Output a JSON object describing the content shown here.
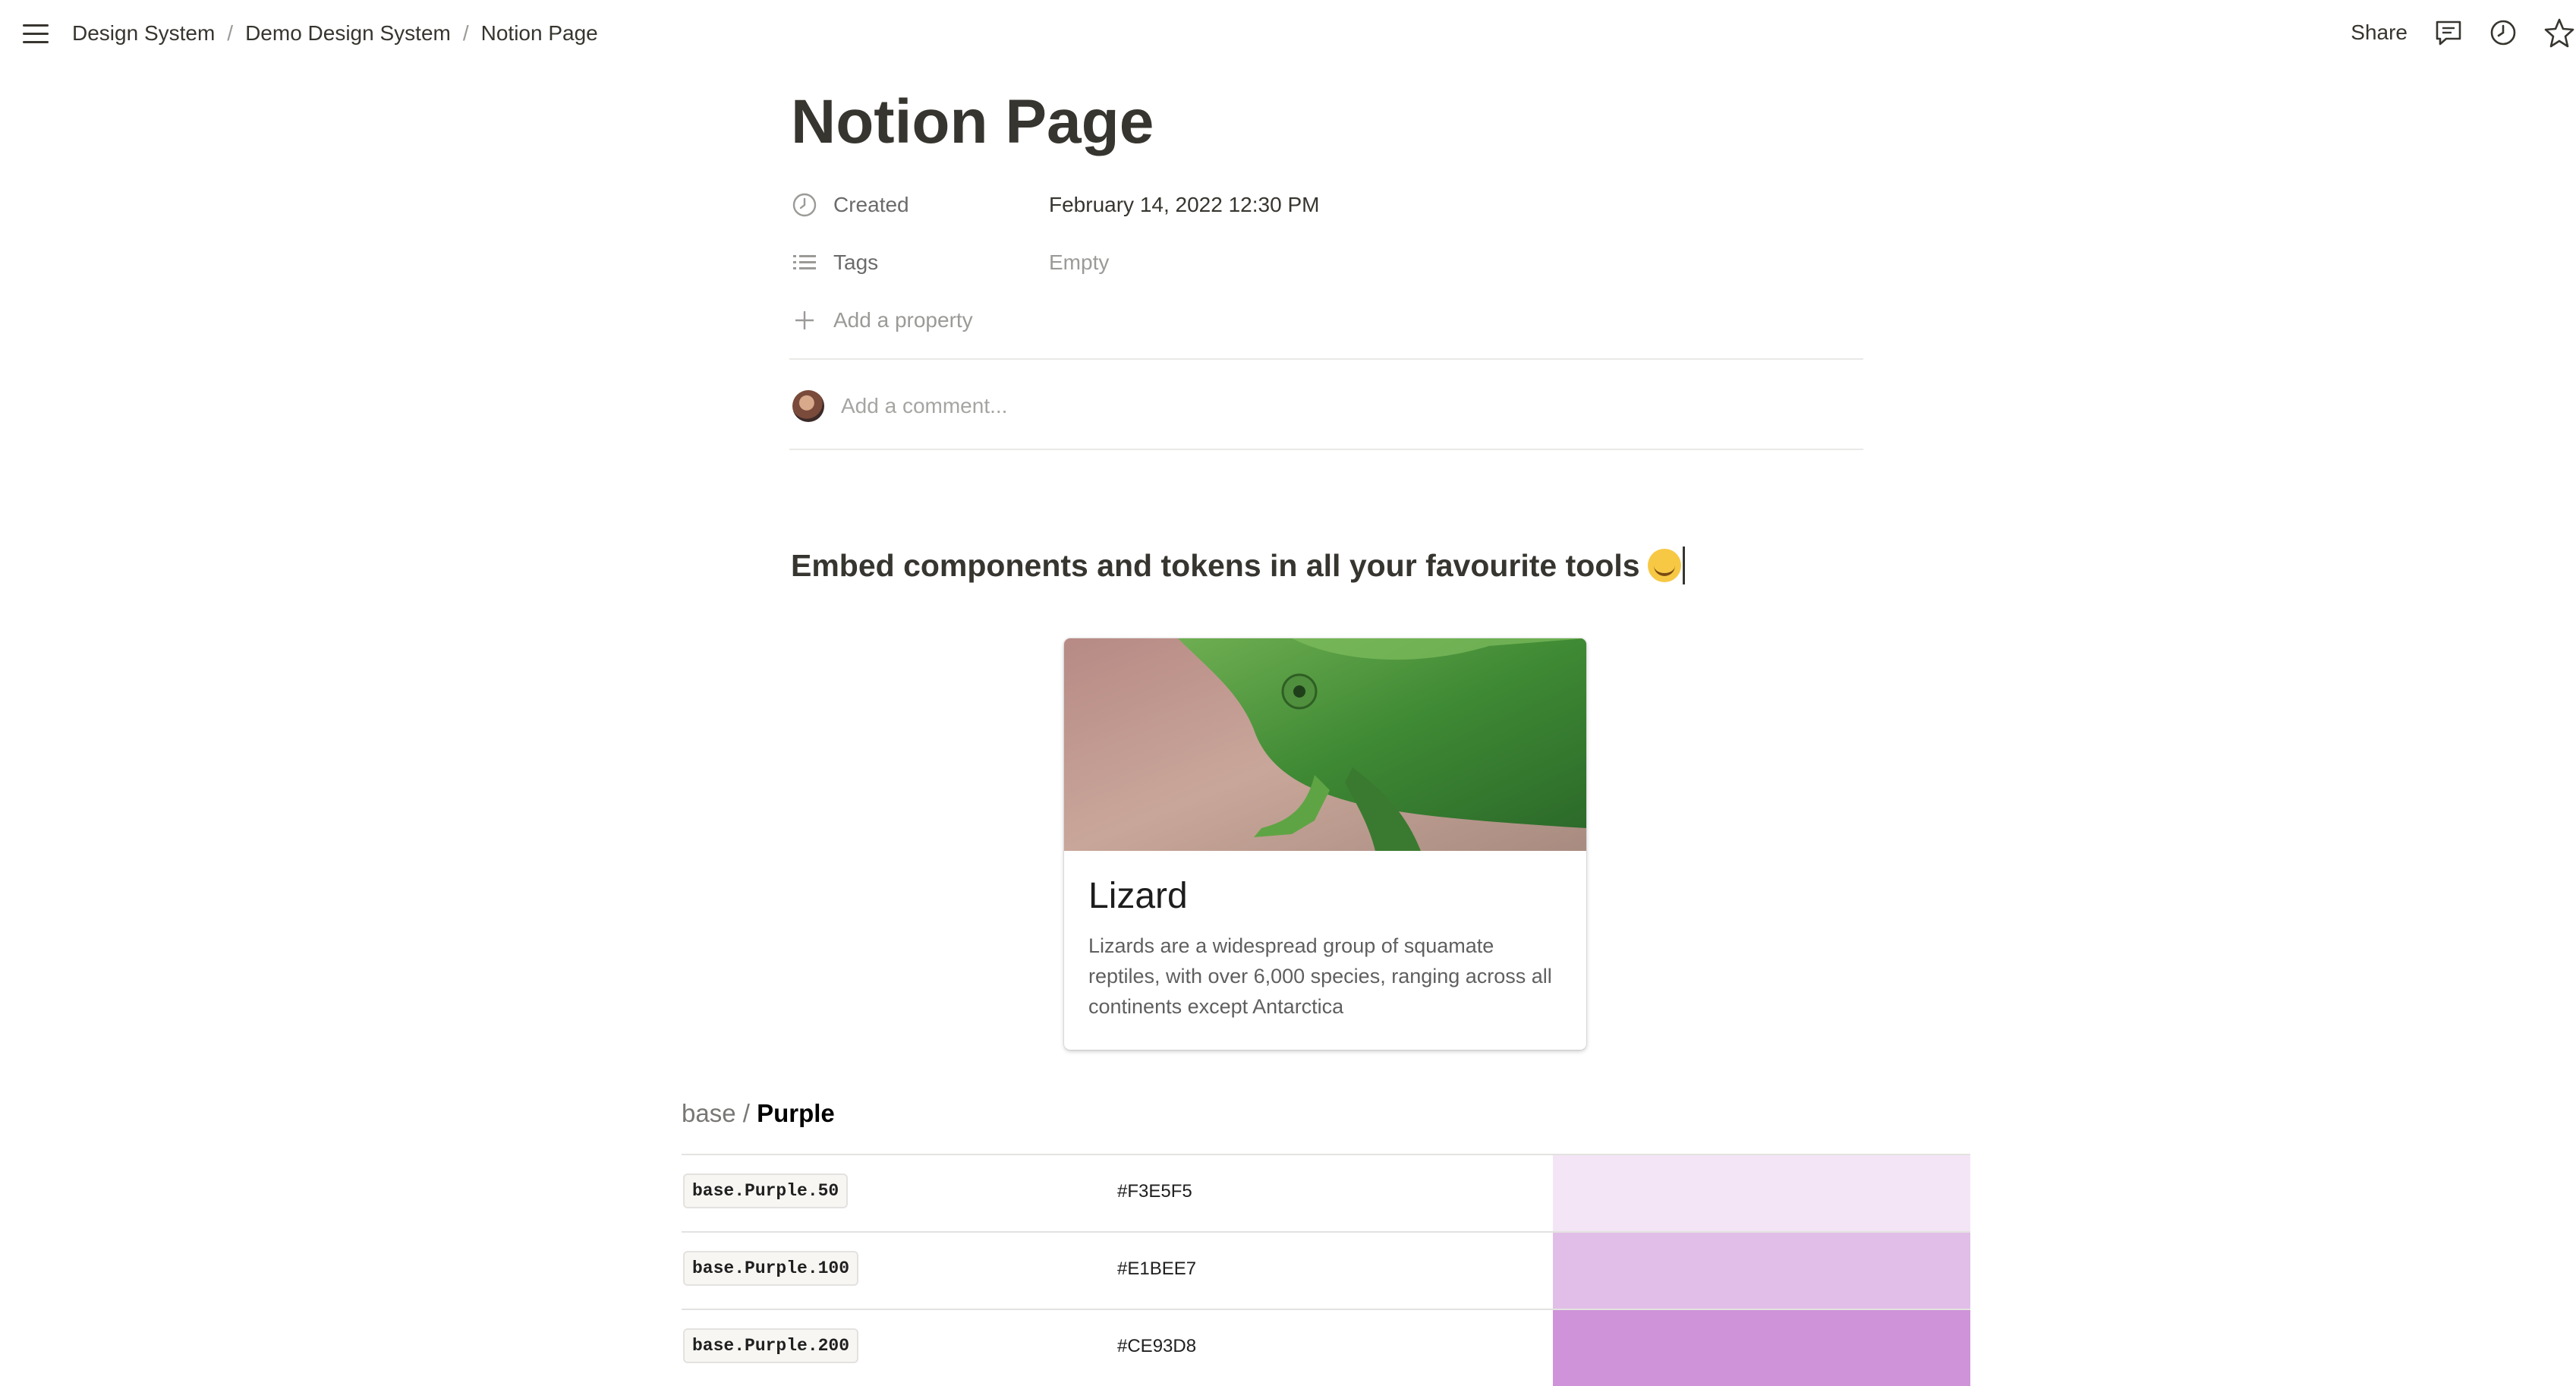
{
  "breadcrumbs": [
    "Design System",
    "Demo Design System",
    "Notion Page"
  ],
  "breadcrumb_separator": "/",
  "top_actions": {
    "share_label": "Share"
  },
  "page": {
    "title": "Notion Page",
    "properties": {
      "created": {
        "name": "Created",
        "value": "February 14, 2022 12:30 PM"
      },
      "tags": {
        "name": "Tags",
        "value": "Empty"
      },
      "add_property_label": "Add a property"
    },
    "comment_placeholder": "Add a comment..."
  },
  "heading": "Embed components and tokens in all your favourite tools",
  "card": {
    "title": "Lizard",
    "description": "Lizards are a widespread group of squamate reptiles, with over 6,000 species, ranging across all continents except Antarctica"
  },
  "tokens": {
    "base_label": "base /",
    "group_label": "Purple",
    "rows": [
      {
        "name": "base.Purple.50",
        "hex": "#F3E5F5",
        "color": "#F3E5F5"
      },
      {
        "name": "base.Purple.100",
        "hex": "#E1BEE7",
        "color": "#E1BEE7"
      },
      {
        "name": "base.Purple.200",
        "hex": "#CE93D8",
        "color": "#CE93D8"
      }
    ]
  },
  "icons": {
    "menu": "hamburger-icon",
    "comments": "comment-icon",
    "history": "clock-icon",
    "favorite": "star-icon",
    "created": "clock-icon",
    "tags": "list-icon",
    "add": "plus-icon"
  }
}
